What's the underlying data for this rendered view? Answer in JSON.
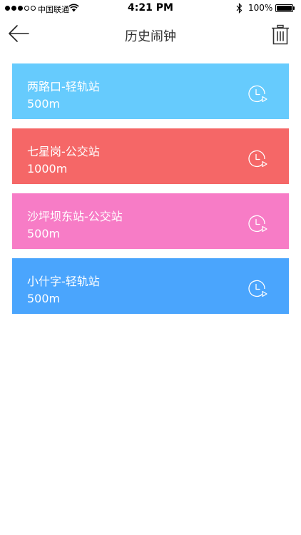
{
  "status_bar": {
    "carrier": "中国联通",
    "time": "4:21 PM",
    "battery": "100%",
    "battery_level": 1.0,
    "signal_strength": 3,
    "signal_max": 5
  },
  "header": {
    "title": "历史闹钟",
    "back_icon": "arrow-left-icon",
    "delete_icon": "trash-icon"
  },
  "alarms": [
    {
      "name": "两路口-轻轨站",
      "distance": "500m",
      "color": "#66cbfd",
      "icon": "alarm-clock-icon"
    },
    {
      "name": "七星岗-公交站",
      "distance": "1000m",
      "color": "#f56767",
      "icon": "alarm-clock-icon"
    },
    {
      "name": "沙坪坝东站-公交站",
      "distance": "500m",
      "color": "#f77cc6",
      "icon": "alarm-clock-icon"
    },
    {
      "name": "小什字-轻轨站",
      "distance": "500m",
      "color": "#4aa5fd",
      "icon": "alarm-clock-icon"
    }
  ]
}
